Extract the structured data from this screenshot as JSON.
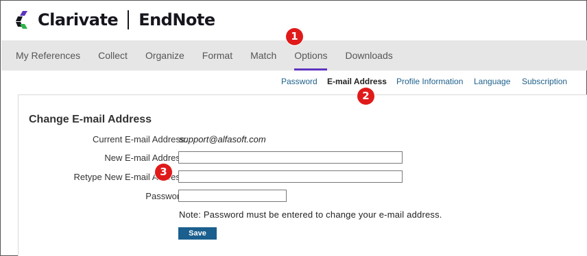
{
  "brand": {
    "company": "Clarivate",
    "product": "EndNote"
  },
  "nav": {
    "items": [
      {
        "label": "My References"
      },
      {
        "label": "Collect"
      },
      {
        "label": "Organize"
      },
      {
        "label": "Format"
      },
      {
        "label": "Match"
      },
      {
        "label": "Options"
      },
      {
        "label": "Downloads"
      }
    ],
    "active": "Options"
  },
  "subnav": {
    "items": [
      {
        "label": "Password"
      },
      {
        "label": "E-mail Address"
      },
      {
        "label": "Profile Information"
      },
      {
        "label": "Language"
      },
      {
        "label": "Subscription"
      }
    ],
    "active": "E-mail Address"
  },
  "form": {
    "title": "Change E-mail Address",
    "current_label": "Current E-mail Address:",
    "current_value": "support@alfasoft.com",
    "new_label": "New E-mail Address:",
    "new_value": "",
    "retype_label": "Retype New E-mail Address:",
    "retype_value": "",
    "password_label": "Password:",
    "password_value": "",
    "note": "Note:  Password must be entered to change your e-mail address.",
    "save_label": "Save"
  },
  "markers": {
    "one": "1",
    "two": "2",
    "three": "3"
  },
  "colors": {
    "accent": "#5e33bf",
    "link": "#1d5f8a",
    "button": "#1b5f8e",
    "marker": "#e01a1a",
    "nav_bg": "#e6e6e6"
  }
}
